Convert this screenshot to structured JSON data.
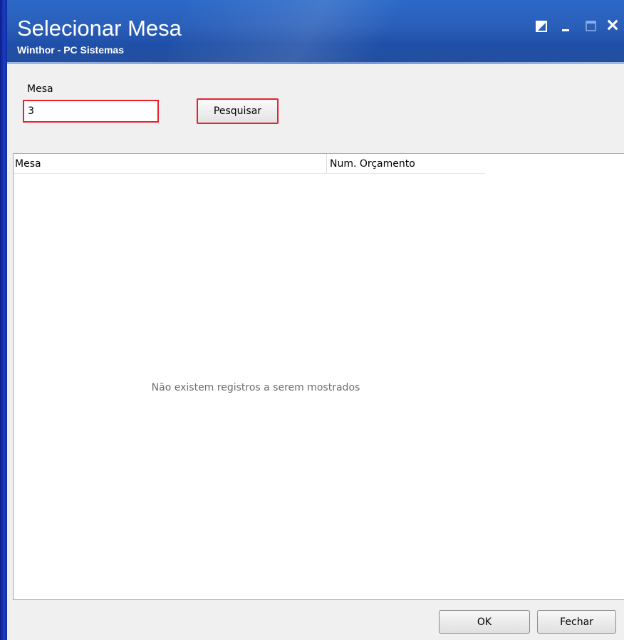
{
  "window": {
    "title": "Selecionar Mesa",
    "subtitle": "Winthor - PC Sistemas"
  },
  "search": {
    "label": "Mesa",
    "value": "3",
    "button_label": "Pesquisar"
  },
  "grid": {
    "columns": [
      "Mesa",
      "Num. Orçamento"
    ],
    "empty_message": "Não existem registros a serem mostrados"
  },
  "footer": {
    "ok_label": "OK",
    "close_label": "Fechar"
  },
  "colors": {
    "titlebar": "#2a5fba",
    "highlight": "#e8212e",
    "frame": "#1c3cc4"
  }
}
